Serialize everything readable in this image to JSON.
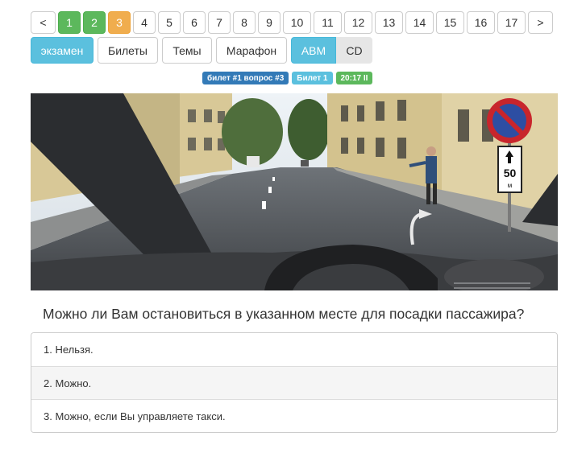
{
  "pagination": {
    "prev": "<",
    "next": ">",
    "pages": [
      "1",
      "2",
      "3",
      "4",
      "5",
      "6",
      "7",
      "8",
      "9",
      "10",
      "11",
      "12",
      "13",
      "14",
      "15",
      "16",
      "17"
    ],
    "answered_correct": [
      "1",
      "2"
    ],
    "current": "3"
  },
  "modes": {
    "exam": "экзамен",
    "tickets": "Билеты",
    "topics": "Темы",
    "marathon": "Марафон",
    "category_abm": "ABM",
    "category_cd": "CD"
  },
  "status": {
    "ticket_question": "билет #1 вопрос #3",
    "ticket": "Билет 1",
    "timer": "20:17 II"
  },
  "sign": {
    "speed_limit": "50",
    "unit": "м"
  },
  "question": "Можно ли Вам остановиться в указанном месте для посадки пассажира?",
  "answers": [
    "1. Нельзя.",
    "2. Можно.",
    "3. Можно, если Вы управляете такси."
  ],
  "colors": {
    "green": "#5cb85c",
    "orange": "#f0ad4e",
    "info": "#5bc0de",
    "primary": "#337ab7"
  }
}
